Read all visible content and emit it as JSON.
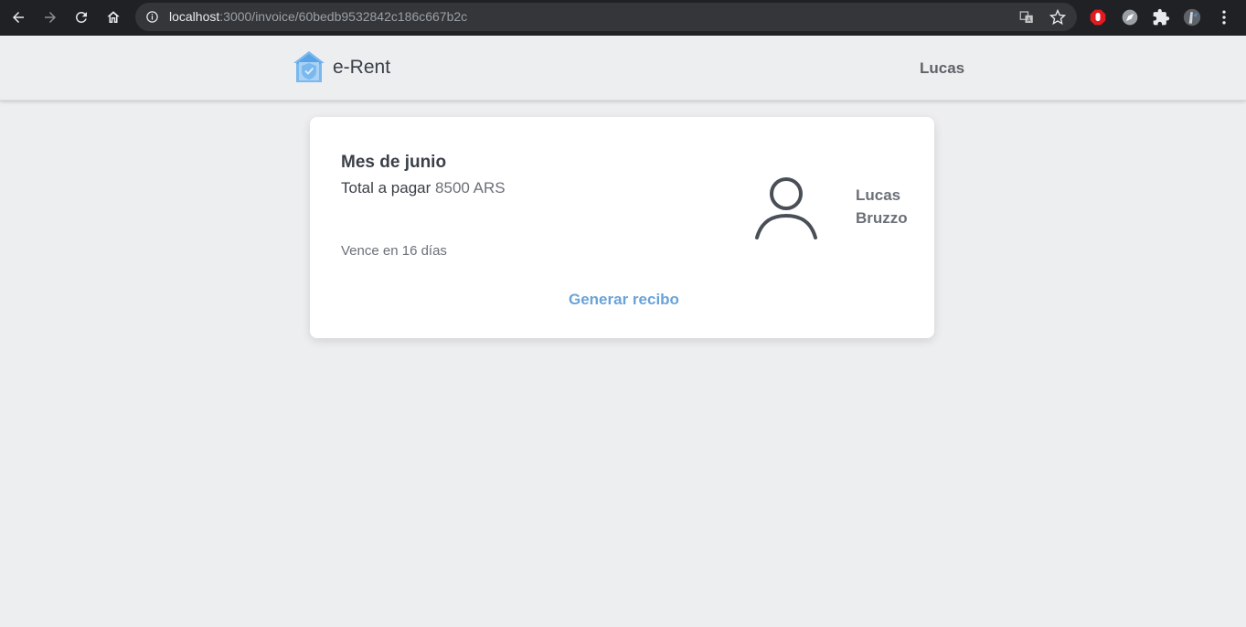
{
  "browser": {
    "url_host": "localhost",
    "url_rest": ":3000/invoice/60bedb9532842c186c667b2c"
  },
  "header": {
    "brand": "e-Rent",
    "user": "Lucas"
  },
  "invoice": {
    "month": "Mes de junio",
    "total_label": "Total a pagar",
    "total_amount": "8500 ARS",
    "due": "Vence en 16 días",
    "tenant_first": "Lucas",
    "tenant_last": "Bruzzo",
    "action": "Generar recibo"
  },
  "colors": {
    "accent": "#6aa3d8",
    "logo": "#64b5f6",
    "text_dark": "#3b4048"
  },
  "icons": [
    "back-icon",
    "forward-icon",
    "reload-icon",
    "home-icon",
    "info-icon",
    "translate-icon",
    "star-icon",
    "adblock-icon",
    "extension-icon",
    "puzzle-icon",
    "profile-icon",
    "menu-icon",
    "house-shield-logo",
    "user-avatar-icon"
  ]
}
